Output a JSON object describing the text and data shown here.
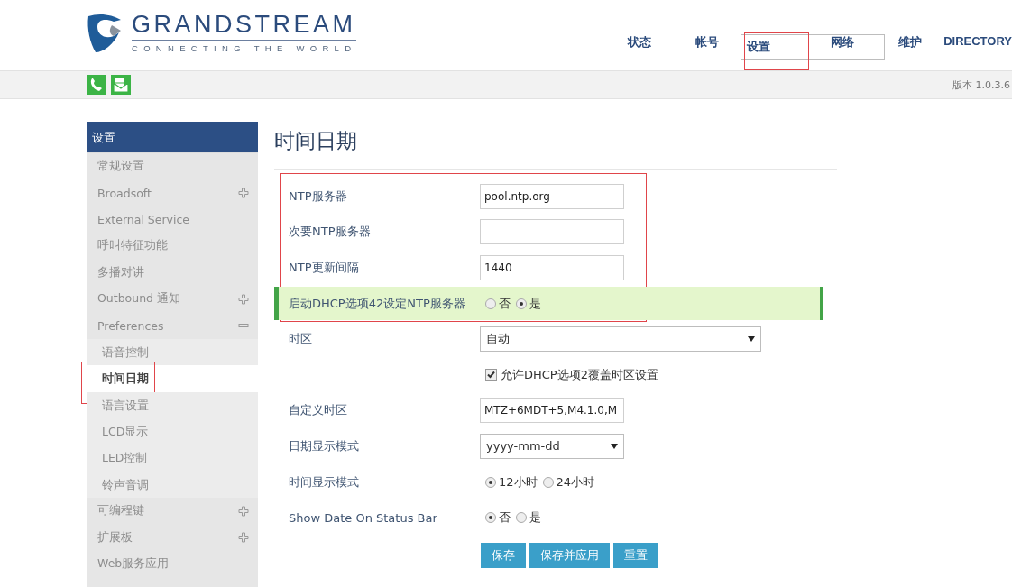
{
  "logo": {
    "name": "GRANDSTREAM",
    "tagline": "CONNECTING THE WORLD"
  },
  "nav": [
    {
      "label": "状态",
      "selected": false
    },
    {
      "label": "帐号",
      "selected": false
    },
    {
      "label": "设置",
      "selected": true
    },
    {
      "label": "网络",
      "selected": false
    },
    {
      "label": "维护",
      "selected": false
    },
    {
      "label": "DIRECTORY",
      "selected": false
    }
  ],
  "version": "版本 1.0.3.6",
  "sidebar": {
    "title": "设置",
    "items": [
      {
        "label": "常规设置"
      },
      {
        "label": "Broadsoft",
        "expanded": false
      },
      {
        "label": "External Service"
      },
      {
        "label": "呼叫特征功能"
      },
      {
        "label": "多播对讲"
      },
      {
        "label": "Outbound 通知",
        "expanded": false
      },
      {
        "label": "Preferences",
        "expanded": true,
        "children": [
          {
            "label": "语音控制",
            "selected": false
          },
          {
            "label": "时间日期",
            "selected": true
          },
          {
            "label": "语言设置",
            "selected": false
          },
          {
            "label": "LCD显示",
            "selected": false
          },
          {
            "label": "LED控制",
            "selected": false
          },
          {
            "label": "铃声音调",
            "selected": false
          }
        ]
      },
      {
        "label": "可编程键",
        "expanded": false
      },
      {
        "label": "扩展板",
        "expanded": false
      },
      {
        "label": "Web服务应用"
      }
    ]
  },
  "page_title": "时间日期",
  "form": {
    "groups": [
      {
        "marked": true,
        "rows": [
          {
            "kind": "text",
            "label": "NTP服务器",
            "value": "pool.ntp.org"
          },
          {
            "kind": "text",
            "label": "次要NTP服务器"
          },
          {
            "kind": "text",
            "label": "NTP更新间隔",
            "value": "1440"
          },
          {
            "kind": "radio",
            "label": "启动DHCP选项42设定NTP服务器",
            "highlighted": true,
            "options": [
              {
                "label": "否",
                "selected": false
              },
              {
                "label": "是",
                "selected": true
              }
            ]
          }
        ]
      },
      {
        "marked": false,
        "rows": [
          {
            "kind": "select",
            "label": "时区",
            "value": "自动",
            "wide": true
          },
          {
            "kind": "checkbox",
            "text": "允许DHCP选项2覆盖时区设置",
            "checked": true
          },
          {
            "kind": "text",
            "label": "自定义时区",
            "value": "MTZ+6MDT+5,M4.1.0,M"
          },
          {
            "kind": "select",
            "label": "日期显示模式",
            "value": "yyyy-mm-dd",
            "wide": false
          },
          {
            "kind": "radio",
            "label": "时间显示模式",
            "highlighted": false,
            "options": [
              {
                "label": "12小时",
                "selected": true
              },
              {
                "label": "24小时",
                "selected": false
              }
            ]
          },
          {
            "kind": "radio",
            "label": "Show Date On Status Bar",
            "highlighted": false,
            "options": [
              {
                "label": "否",
                "selected": true
              },
              {
                "label": "是",
                "selected": false
              }
            ]
          }
        ]
      }
    ]
  },
  "buttons": [
    "保存",
    "保存并应用",
    "重置"
  ]
}
